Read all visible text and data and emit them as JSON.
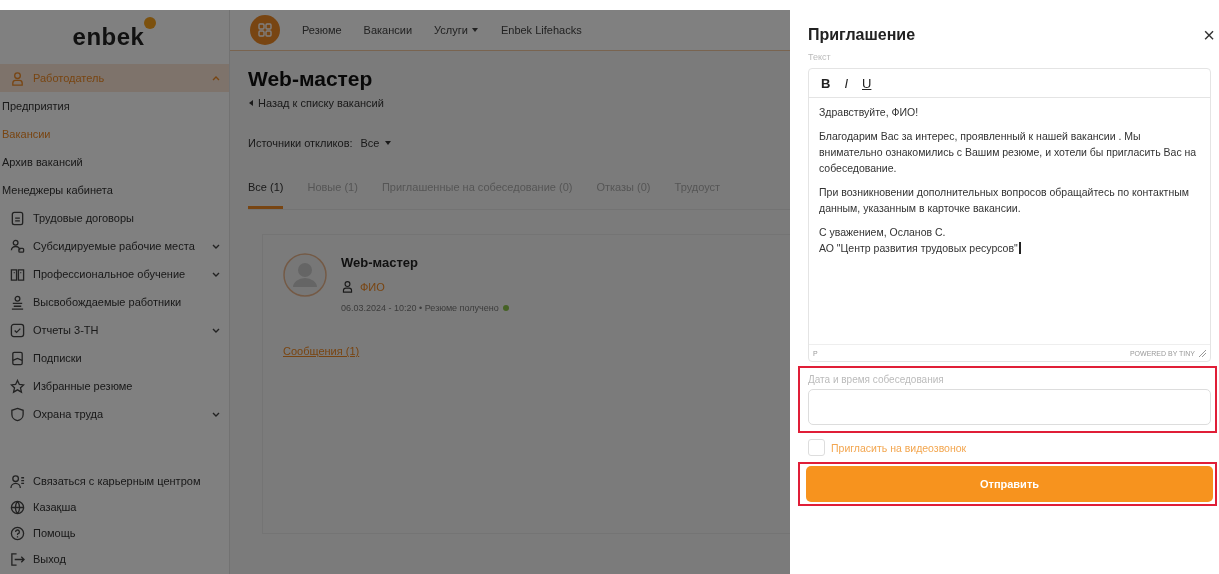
{
  "sidebar": {
    "logo": "enbek",
    "items": [
      {
        "label": "Работодатель",
        "selected": true,
        "expanded": true,
        "children": [
          {
            "label": "Предприятия",
            "selected": false
          },
          {
            "label": "Вакансии",
            "selected": true
          },
          {
            "label": "Архив вакансий",
            "selected": false
          },
          {
            "label": "Менеджеры кабинета",
            "selected": false
          }
        ]
      },
      {
        "label": "Трудовые договоры",
        "selected": false
      },
      {
        "label": "Субсидируемые рабочие места",
        "selected": false,
        "expanded": false
      },
      {
        "label": "Профессиональное обучение",
        "selected": false,
        "expanded": false
      },
      {
        "label": "Высвобождаемые работники",
        "selected": false
      },
      {
        "label": "Отчеты 3-ТН",
        "selected": false,
        "expanded": false
      },
      {
        "label": "Подписки",
        "selected": false
      },
      {
        "label": "Избранные резюме",
        "selected": false
      },
      {
        "label": "Охрана труда",
        "selected": false,
        "expanded": false
      }
    ],
    "bottom_items": [
      {
        "label": "Связаться с карьерным центром"
      },
      {
        "label": "Казақша"
      },
      {
        "label": "Помощь"
      },
      {
        "label": "Выход"
      }
    ]
  },
  "nav": {
    "items": [
      {
        "label": "Резюме",
        "dropdown": false
      },
      {
        "label": "Вакансии",
        "dropdown": false
      },
      {
        "label": "Услуги",
        "dropdown": true
      },
      {
        "label": "Enbek Lifehacks",
        "dropdown": false
      }
    ]
  },
  "main": {
    "title": "Web-мастер",
    "back_link": "Назад к списку вакансий",
    "source_filter": {
      "label": "Источники откликов:",
      "value": "Все"
    },
    "tabs": [
      {
        "label": "Все (1)",
        "selected": true
      },
      {
        "label": "Новые (1)",
        "selected": false
      },
      {
        "label": "Приглашенные на собеседование (0)",
        "selected": false
      },
      {
        "label": "Отказы (0)",
        "selected": false
      },
      {
        "label": "Трудоуст",
        "selected": false
      }
    ],
    "response": {
      "title": "Web-мастер",
      "name": "ФИО",
      "meta": "06.03.2024 - 10:20 • Резюме получено",
      "messages_link": "Сообщения (1)"
    }
  },
  "modal": {
    "title": "Приглашение",
    "close": "×",
    "text_label": "Текст",
    "toolbar": [
      "B",
      "I",
      "U"
    ],
    "body": [
      {
        "lines": [
          "Здравствуйте, ФИО!"
        ]
      },
      {
        "lines": [
          "Благодарим Вас за интерес, проявленный к нашей вакансии . Мы внимательно ознакомились с Вашим резюме, и хотели бы пригласить Вас на собеседование."
        ]
      },
      {
        "lines": [
          "При возникновении дополнительных вопросов обращайтесь по контактным данным, указанным в карточке вакансии."
        ]
      },
      {
        "lines": [
          "С уважением, Осланов С.",
          "АО \"Центр развития трудовых ресурсов\""
        ]
      }
    ],
    "path": "P",
    "powered_by": "POWERED BY TINY",
    "date_field": {
      "label": "Дата и время собеседования",
      "highlighted": true
    },
    "video_call": {
      "label": "Пригласить на видеозвонок",
      "checked": false
    },
    "submit": {
      "label": "Отправить",
      "highlighted": true
    }
  }
}
